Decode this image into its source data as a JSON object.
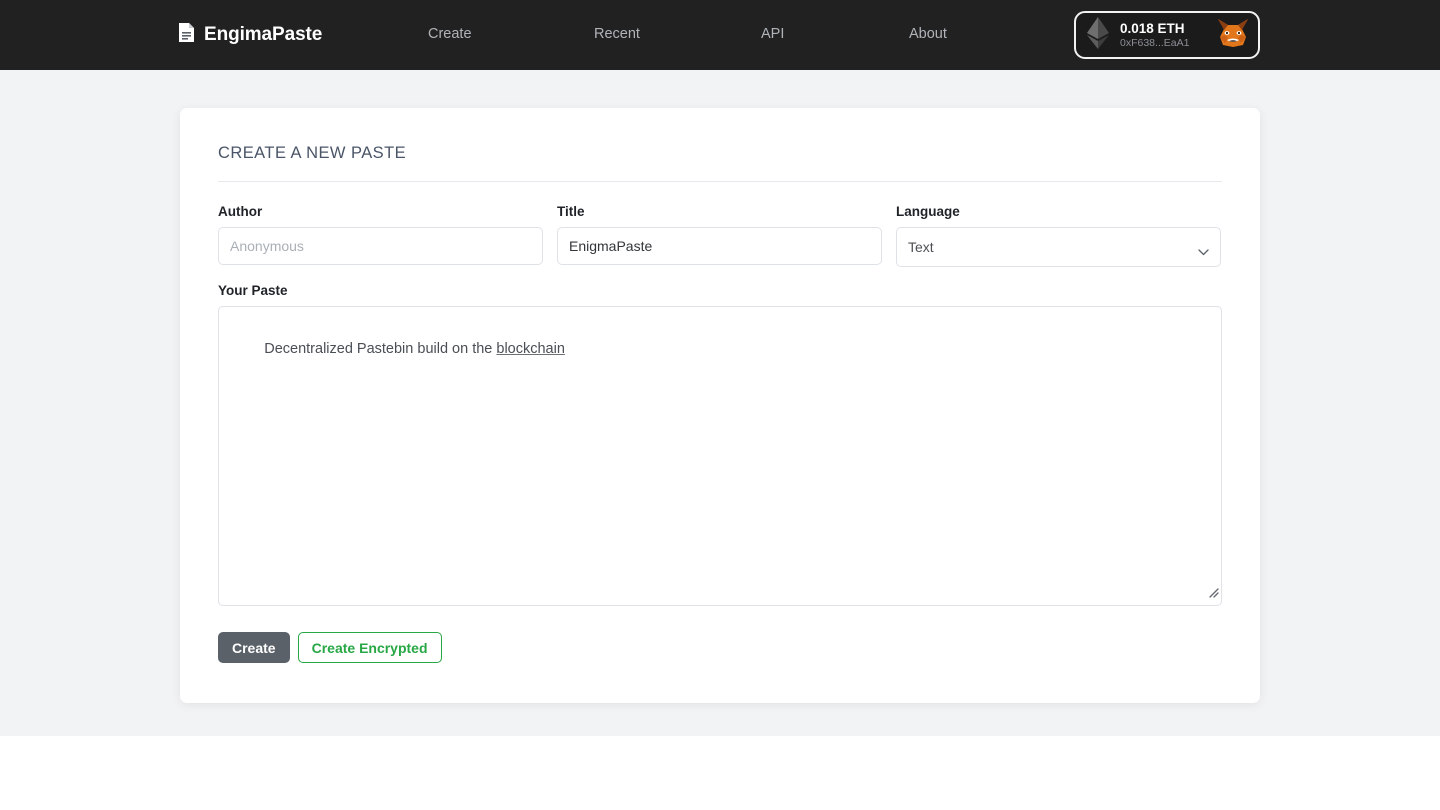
{
  "header": {
    "brand": {
      "name": "EngimaPaste",
      "icon": "document-icon"
    },
    "nav": [
      {
        "label": "Create"
      },
      {
        "label": "Recent"
      },
      {
        "label": "API"
      },
      {
        "label": "About"
      }
    ],
    "wallet": {
      "chain_icon": "ethereum-icon",
      "balance": "0.018 ETH",
      "address": "0xF638...EaA1",
      "provider_icon": "metamask-fox-icon"
    }
  },
  "main": {
    "card_title": "CREATE A NEW PASTE",
    "fields": {
      "author": {
        "label": "Author",
        "value": "",
        "placeholder": "Anonymous"
      },
      "title": {
        "label": "Title",
        "value": "EnigmaPaste",
        "placeholder": ""
      },
      "language": {
        "label": "Language",
        "selected": "Text",
        "icon": "chevron-down-icon"
      },
      "paste": {
        "label": "Your Paste",
        "text_before": "Decentralized Pastebin build on the ",
        "spellchecked_word": "blockchain",
        "placeholder": ""
      }
    },
    "buttons": {
      "create": "Create",
      "create_encrypted": "Create Encrypted"
    }
  },
  "colors": {
    "header_bg": "#212121",
    "page_bg": "#f1f3f5",
    "card_bg": "#ffffff",
    "create_button": "#5a6169",
    "encrypted_green": "#28a745",
    "metamask_orange": "#e2761b"
  }
}
